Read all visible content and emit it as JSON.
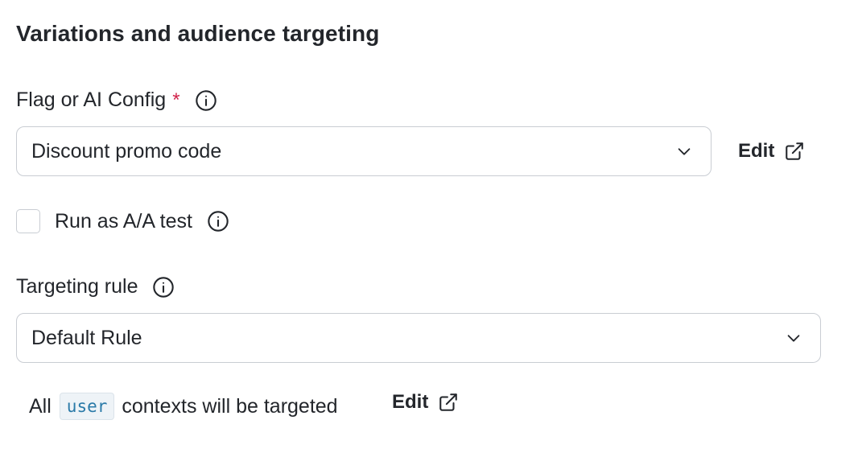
{
  "section": {
    "title": "Variations and audience targeting"
  },
  "flag_field": {
    "label": "Flag or AI Config",
    "required_marker": "*",
    "selected": "Discount promo code",
    "edit_label": "Edit"
  },
  "aa_test": {
    "label": "Run as A/A test",
    "checked": false
  },
  "targeting_field": {
    "label": "Targeting rule",
    "selected": "Default Rule"
  },
  "context_note": {
    "prefix": "All",
    "context_kind": "user",
    "suffix": "contexts will be targeted",
    "edit_label": "Edit"
  },
  "icons": {
    "info": "info-circle-icon",
    "chevron": "chevron-down-icon",
    "external": "external-link-icon"
  },
  "colors": {
    "required": "#d1234a",
    "code_text": "#2a7aa8",
    "border": "#c9cdd3"
  }
}
